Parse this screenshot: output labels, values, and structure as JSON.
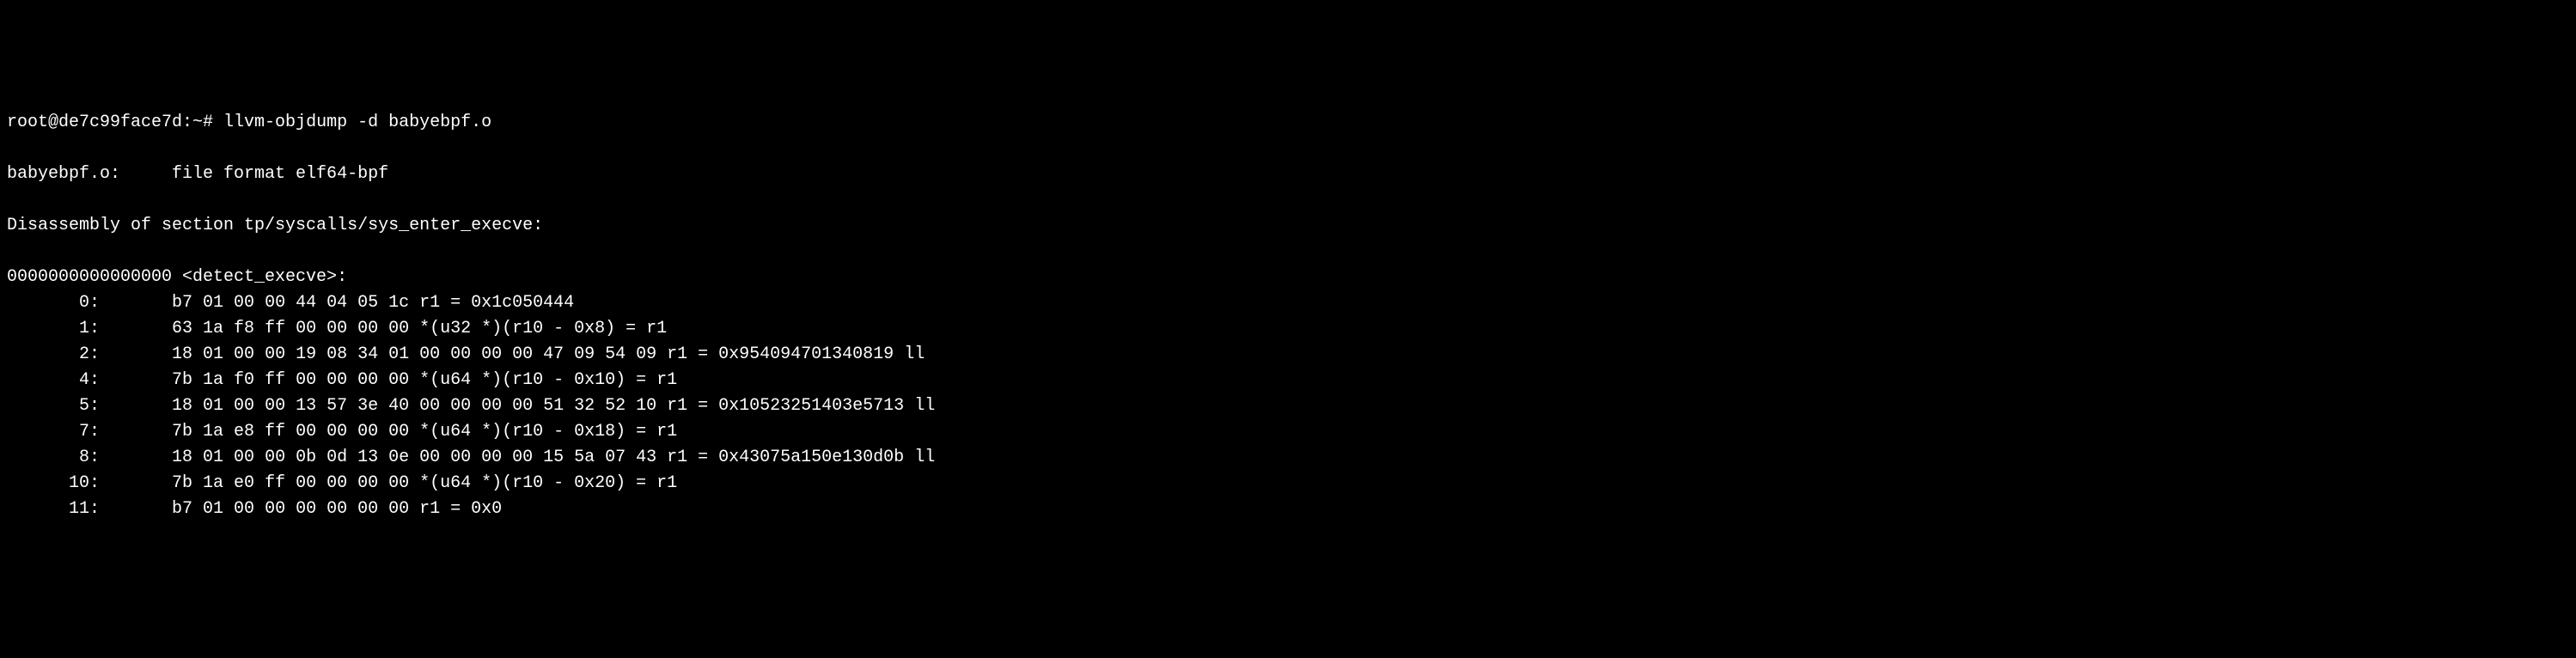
{
  "prompt": "root@de7c99face7d:~# ",
  "command": "llvm-objdump -d babyebpf.o",
  "file_header": "babyebpf.o:     file format elf64-bpf",
  "section_header": "Disassembly of section tp/syscalls/sys_enter_execve:",
  "function_header": "0000000000000000 <detect_execve>:",
  "instructions": [
    {
      "offset": "       0:",
      "bytes": "       b7 01 00 00 44 04 05 1c",
      "asm": " r1 = 0x1c050444"
    },
    {
      "offset": "       1:",
      "bytes": "       63 1a f8 ff 00 00 00 00",
      "asm": " *(u32 *)(r10 - 0x8) = r1"
    },
    {
      "offset": "       2:",
      "bytes": "       18 01 00 00 19 08 34 01 00 00 00 00 47 09 54 09",
      "asm": " r1 = 0x954094701340819 ll"
    },
    {
      "offset": "       4:",
      "bytes": "       7b 1a f0 ff 00 00 00 00",
      "asm": " *(u64 *)(r10 - 0x10) = r1"
    },
    {
      "offset": "       5:",
      "bytes": "       18 01 00 00 13 57 3e 40 00 00 00 00 51 32 52 10",
      "asm": " r1 = 0x10523251403e5713 ll"
    },
    {
      "offset": "       7:",
      "bytes": "       7b 1a e8 ff 00 00 00 00",
      "asm": " *(u64 *)(r10 - 0x18) = r1"
    },
    {
      "offset": "       8:",
      "bytes": "       18 01 00 00 0b 0d 13 0e 00 00 00 00 15 5a 07 43",
      "asm": " r1 = 0x43075a150e130d0b ll"
    },
    {
      "offset": "      10:",
      "bytes": "       7b 1a e0 ff 00 00 00 00",
      "asm": " *(u64 *)(r10 - 0x20) = r1"
    },
    {
      "offset": "      11:",
      "bytes": "       b7 01 00 00 00 00 00 00",
      "asm": " r1 = 0x0"
    }
  ]
}
